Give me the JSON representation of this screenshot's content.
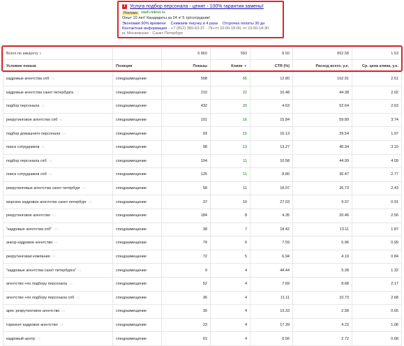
{
  "ad": {
    "favicon_label": "Т",
    "title": "Услуга подбор персонала - ценят - 100% гарантия замены!",
    "badge": "Реклама",
    "url": "vash-rekrut.ru",
    "text": "Опыт 10 лет! Кандидаты за 24 ч! 5 тр/сотрудник!",
    "links": [
      "Экономия 90% времени",
      "Снижаем текучку в 4 раза",
      "Отсрочка оплаты 30 дн"
    ],
    "contact_label": "Контактная информация",
    "phone": "+7 (812) 389-63-37",
    "hours": "Пн-пт 10:00-18:00, пт 10:00-18:30",
    "metro": "м. Московская",
    "city": "Санкт-Петербург"
  },
  "totals": {
    "label": "Всего по аккаунту",
    "shows": "6 860",
    "clicks": "583",
    "ctr": "8.50",
    "spend": "892.58",
    "avg_cpc": "1.53"
  },
  "headers": {
    "condition": "Условие показа",
    "position": "Позиция",
    "shows": "Показы",
    "clicks": "Клики",
    "ctr": "CTR (%)",
    "spend": "Расход всего, у.е.",
    "avg_cpc": "Ср. цена клика, у.е."
  },
  "rows": [
    {
      "keyword": "кадровые агентства спб",
      "position": "спецразмещение",
      "shows": "508",
      "clicks": "65",
      "ctr": "12.80",
      "spend": "162.91",
      "cpc": "2.51",
      "hi": true
    },
    {
      "keyword": "кадровые агентства санкт петербурга",
      "position": "спецразмещение",
      "shows": "210",
      "clicks": "22",
      "ctr": "10.48",
      "spend": "44.38",
      "cpc": "2.02",
      "hi": true
    },
    {
      "keyword": "подбор персонала",
      "position": "спецразмещение",
      "shows": "432",
      "clicks": "20",
      "ctr": "4.63",
      "spend": "52.64",
      "cpc": "2.63",
      "hi": true
    },
    {
      "keyword": "рекрутинговое агентство спб",
      "position": "спецразмещение",
      "shows": "101",
      "clicks": "16",
      "ctr": "15.84",
      "spend": "59.80",
      "cpc": "3.74",
      "hi": true
    },
    {
      "keyword": "подбор домашнего персонала",
      "position": "спецразмещение",
      "shows": "93",
      "clicks": "15",
      "ctr": "16.13",
      "spend": "29.54",
      "cpc": "1.97",
      "hi": true
    },
    {
      "keyword": "поиск сотрудников",
      "position": "спецразмещение",
      "shows": "98",
      "clicks": "13",
      "ctr": "13.27",
      "spend": "40.34",
      "cpc": "3.10",
      "hi": true
    },
    {
      "keyword": "подбор персонала спб",
      "position": "спецразмещение",
      "shows": "104",
      "clicks": "11",
      "ctr": "10.58",
      "spend": "44.99",
      "cpc": "4.09",
      "hi": true
    },
    {
      "keyword": "поиск сотрудников спб",
      "position": "спецразмещение",
      "shows": "125",
      "clicks": "11",
      "ctr": "8.80",
      "spend": "30.47",
      "cpc": "2.77",
      "hi": true
    },
    {
      "keyword": "рекрутинговые агентства санкт петербург",
      "position": "спецразмещение",
      "shows": "58",
      "clicks": "11",
      "ctr": "18.97",
      "spend": "26.73",
      "cpc": "2.43",
      "hi": false
    },
    {
      "keyword": "морское кадровое агентство санкт петербург",
      "position": "спецразмещение",
      "shows": "37",
      "clicks": "10",
      "ctr": "27.03",
      "spend": "9.07",
      "cpc": "0.91",
      "hi": false
    },
    {
      "keyword": "рекрутинговое агентство",
      "position": "спецразмещение",
      "shows": "184",
      "clicks": "8",
      "ctr": "4.35",
      "spend": "20.46",
      "cpc": "2.56",
      "hi": false
    },
    {
      "keyword": "\"кадровые агентства спб\"",
      "position": "спецразмещение",
      "shows": "38",
      "clicks": "7",
      "ctr": "18.42",
      "spend": "13.11",
      "cpc": "1.87",
      "hi": false
    },
    {
      "keyword": "анкор кадровое агентство",
      "position": "спецразмещение",
      "shows": "79",
      "clicks": "6",
      "ctr": "7.59",
      "spend": "5.96",
      "cpc": "0.99",
      "hi": false
    },
    {
      "keyword": "рекрутинговая компания",
      "position": "спецразмещение",
      "shows": "72",
      "clicks": "5",
      "ctr": "6.94",
      "spend": "4.19",
      "cpc": "0.84",
      "hi": false
    },
    {
      "keyword": "\"кадровые агентства санкт петербурга\"",
      "position": "спецразмещение",
      "shows": "9",
      "clicks": "4",
      "ctr": "44.44",
      "spend": "5.28",
      "cpc": "1.32",
      "hi": false
    },
    {
      "keyword": "агентство +по подбору персонала",
      "position": "спецразмещение",
      "shows": "52",
      "clicks": "4",
      "ctr": "7.69",
      "spend": "8.68",
      "cpc": "2.17",
      "hi": false
    },
    {
      "keyword": "агентство +по подбору персонала спб",
      "position": "спецразмещение",
      "shows": "36",
      "clicks": "4",
      "ctr": "11.11",
      "spend": "10.73",
      "cpc": "2.68",
      "hi": false
    },
    {
      "keyword": "арес рекрутинговое агентство",
      "position": "спецразмещение",
      "shows": "30",
      "clicks": "4",
      "ctr": "13.33",
      "spend": "2.58",
      "cpc": "0.65",
      "hi": false
    },
    {
      "keyword": "горизонт кадровое агентство",
      "position": "спецразмещение",
      "shows": "23",
      "clicks": "4",
      "ctr": "17.39",
      "spend": "4.23",
      "cpc": "1.06",
      "hi": false
    },
    {
      "keyword": "кадровый центр",
      "position": "спецразмещение",
      "shows": "61",
      "clicks": "4",
      "ctr": "6.56",
      "spend": "2.72",
      "cpc": "0.68",
      "hi": false
    }
  ],
  "colors": {
    "highlight": "#d8262c",
    "link": "#1a0dab",
    "url": "#007700",
    "clicks_green": "#008000"
  }
}
